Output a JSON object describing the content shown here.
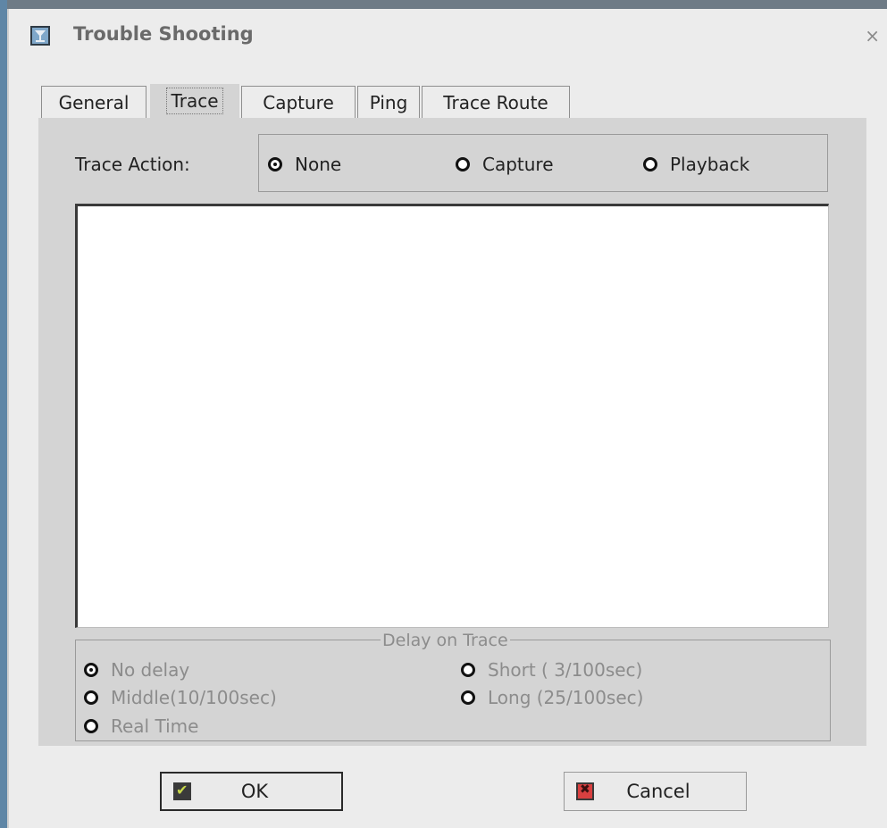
{
  "window": {
    "title": "Trouble Shooting",
    "close_icon": "close-icon",
    "app_icon": "trouble-shooting-icon"
  },
  "tabs": [
    {
      "label": "General",
      "active": false
    },
    {
      "label": "Trace",
      "active": true
    },
    {
      "label": "Capture",
      "active": false
    },
    {
      "label": "Ping",
      "active": false
    },
    {
      "label": "Trace Route",
      "active": false
    }
  ],
  "trace_action": {
    "label": "Trace Action:",
    "options": [
      {
        "label": "None",
        "selected": true
      },
      {
        "label": "Capture",
        "selected": false
      },
      {
        "label": "Playback",
        "selected": false
      }
    ]
  },
  "trace_output": {
    "text": ""
  },
  "delay": {
    "legend": "Delay on Trace",
    "enabled": false,
    "options": [
      {
        "label": "No delay",
        "selected": true
      },
      {
        "label": "Short ( 3/100sec)",
        "selected": false
      },
      {
        "label": "Middle(10/100sec)",
        "selected": false
      },
      {
        "label": "Long  (25/100sec)",
        "selected": false
      },
      {
        "label": "Real Time",
        "selected": false
      }
    ]
  },
  "buttons": {
    "ok_label": "OK",
    "cancel_label": "Cancel"
  },
  "colors": {
    "panel": "#d4d4d4",
    "window": "#ececec",
    "border_accent": "#5f86a6"
  }
}
